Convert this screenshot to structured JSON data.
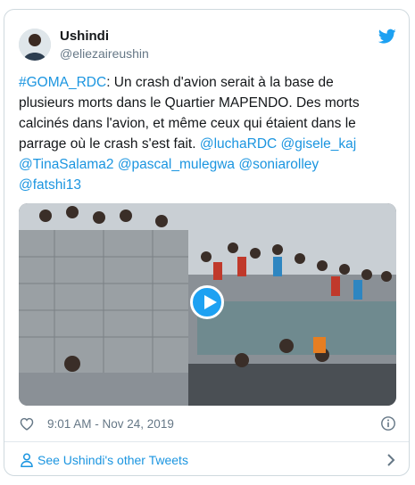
{
  "user": {
    "display_name": "Ushindi",
    "handle": "@eliezaireushin"
  },
  "tweet": {
    "hashtag": "#GOMA_RDC",
    "body": ": Un crash d'avion serait à la base de plusieurs morts dans le Quartier MAPENDO. Des morts calcinés dans l'avion, et même ceux qui étaient dans le parrage où le crash s'est fait. ",
    "mentions": [
      "@luchaRDC",
      "@gisele_kaj",
      "@TinaSalama2",
      "@pascal_mulegwa",
      "@soniarolley",
      "@fatshi13"
    ]
  },
  "footer": {
    "timestamp": "9:01 AM - Nov 24, 2019"
  },
  "more_tweets_label": "See Ushindi's other Tweets",
  "icons": {
    "brand": "twitter-bird-icon",
    "like": "heart-icon",
    "info": "info-icon",
    "profile": "person-icon",
    "nav": "chevron-right-icon",
    "media": "play-icon"
  },
  "colors": {
    "link": "#1b95e0",
    "brand": "#1da1f2",
    "muted": "#657786",
    "border": "#cfd9de"
  }
}
